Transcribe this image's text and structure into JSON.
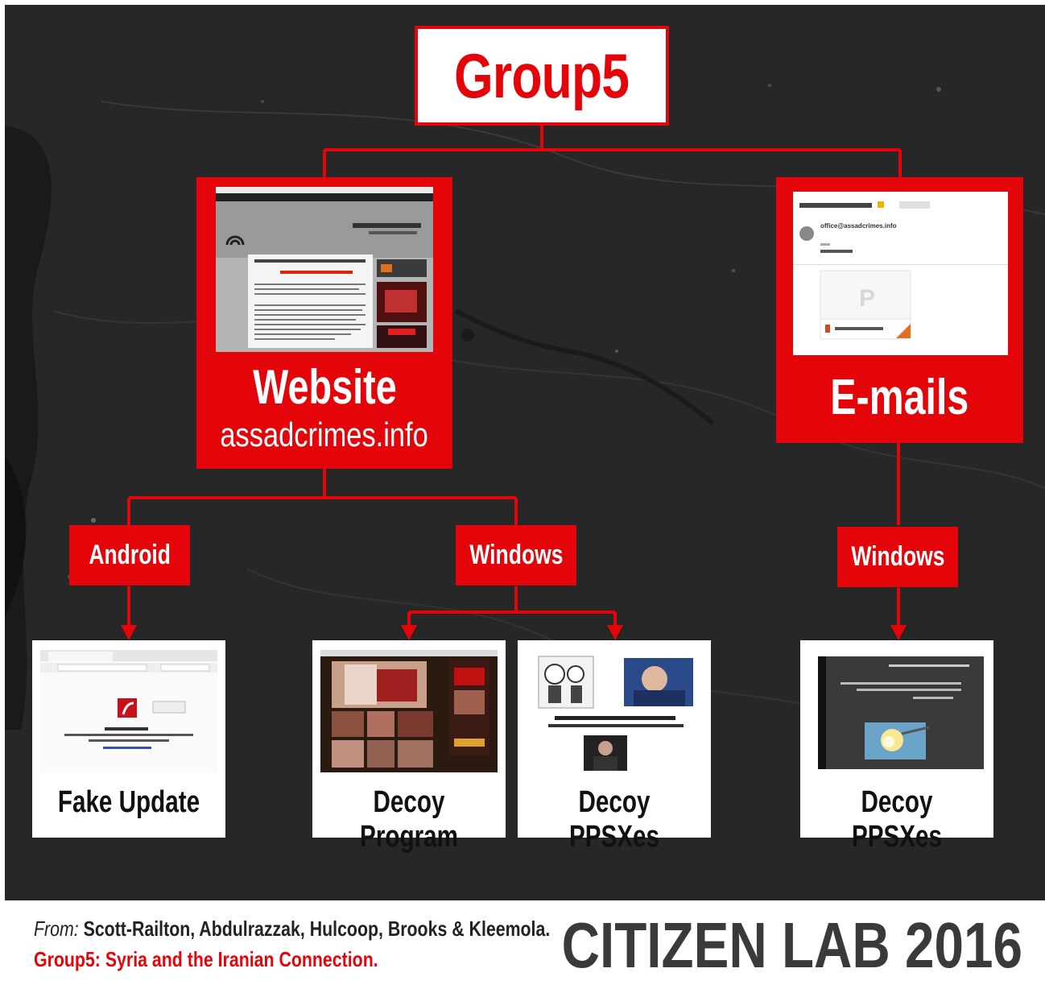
{
  "root": {
    "label": "Group5"
  },
  "vectors": [
    {
      "title": "Website",
      "subtitle": "assadcrimes.info",
      "screenshot_label": "website-screenshot"
    },
    {
      "title": "E-mails",
      "screenshot_label": "email-screenshot",
      "email_sender": "office@assadcrimes.info"
    }
  ],
  "platforms": [
    "Android",
    "Windows",
    "Windows"
  ],
  "payloads": [
    "Fake Update",
    "Decoy Program",
    "Decoy PPSXes",
    "Decoy PPSXes"
  ],
  "footer": {
    "from_label": "From:",
    "authors": "Scott-Railton, Abdulrazzak, Hulcoop, Brooks & Kleemola.",
    "paper_title": "Group5: Syria and the Iranian Connection.",
    "brand": "CITIZEN LAB 2016"
  },
  "colors": {
    "accent": "#e3050a",
    "background": "#262626",
    "brand_text": "#3a3a3a"
  }
}
